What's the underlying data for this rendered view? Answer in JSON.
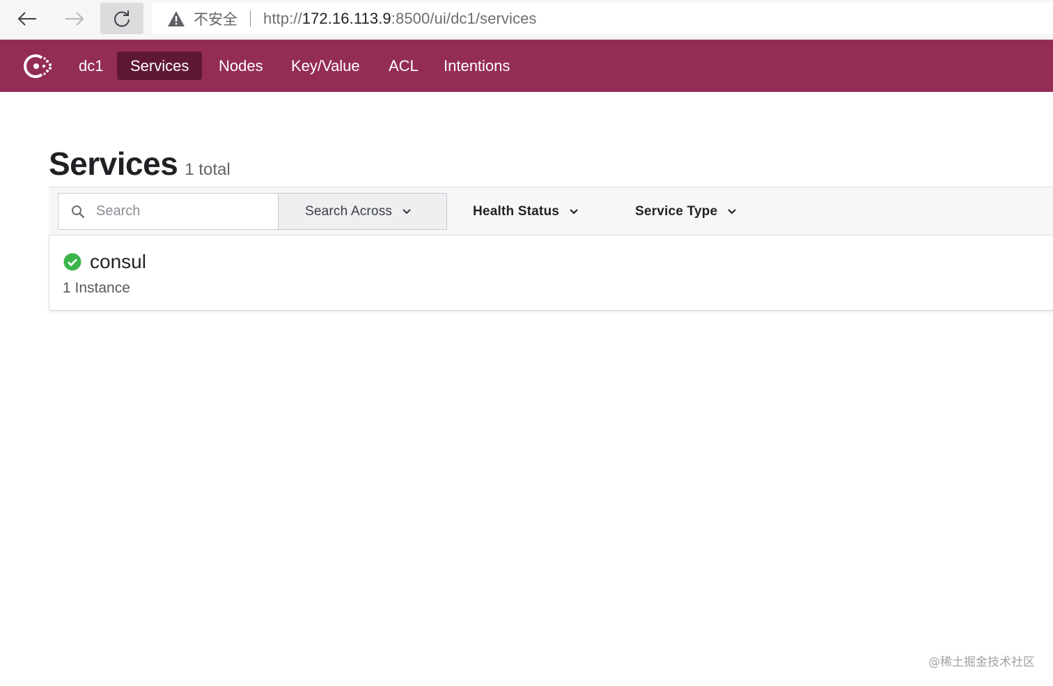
{
  "browser": {
    "security_label": "不安全",
    "url_scheme": "http://",
    "url_host": "172.16.113.9",
    "url_rest": ":8500/ui/dc1/services"
  },
  "header": {
    "brand_color": "#942d56",
    "active_color": "#5e1734",
    "datacenter": "dc1",
    "nav": [
      {
        "label": "Services",
        "active": true
      },
      {
        "label": "Nodes",
        "active": false
      },
      {
        "label": "Key/Value",
        "active": false
      },
      {
        "label": "ACL",
        "active": false
      },
      {
        "label": "Intentions",
        "active": false
      }
    ]
  },
  "page": {
    "title": "Services",
    "count": "1 total"
  },
  "filters": {
    "search_placeholder": "Search",
    "search_across": "Search Across",
    "health_status": "Health Status",
    "service_type": "Service Type"
  },
  "services": [
    {
      "name": "consul",
      "instances": "1 Instance",
      "status": "passing",
      "status_color": "#3bb54a"
    }
  ],
  "watermark": "@稀土掘金技术社区"
}
